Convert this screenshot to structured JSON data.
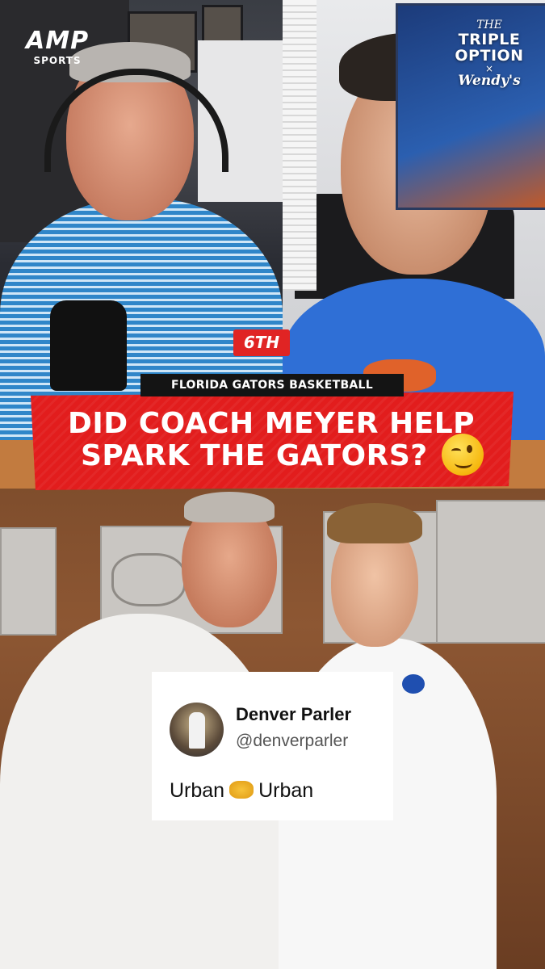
{
  "branding": {
    "amp_logo": "AMP",
    "amp_sub": "SPORTS",
    "show_the": "THE",
    "show_name_1": "TRIPLE",
    "show_name_2": "OPTION",
    "show_x": "×",
    "sponsor": "Wendy's"
  },
  "rank_badge": "6TH",
  "category": "FLORIDA GATORS BASKETBALL",
  "headline": {
    "line1": "DID COACH MEYER HELP",
    "line2": "SPARK THE GATORS?"
  },
  "emoji": "winking-face",
  "tweet": {
    "name": "Denver Parler",
    "handle": "@denverparler",
    "text_before": "Urban",
    "text_emoji": "handshake",
    "text_after": "Urban"
  },
  "colors": {
    "banner_red": "#e21d1d",
    "label_black": "#141414",
    "shirt_blue": "#2f6fd6"
  }
}
